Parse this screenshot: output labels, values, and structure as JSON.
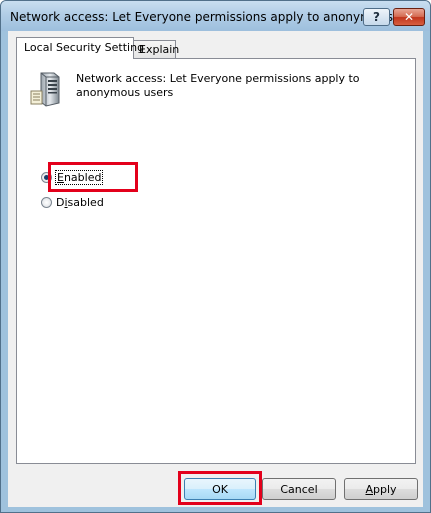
{
  "window": {
    "title": "Network access: Let Everyone permissions apply to anonymous...",
    "help_label": "?",
    "close_label": "✕"
  },
  "tabs": [
    {
      "label": "Local Security Setting",
      "active": true
    },
    {
      "label": "Explain",
      "active": false
    }
  ],
  "policy": {
    "icon": "server-icon",
    "description": "Network access: Let Everyone permissions apply to anonymous users"
  },
  "options": {
    "enabled": {
      "prefix": "",
      "mnemonic": "E",
      "rest": "nabled",
      "checked": true
    },
    "disabled": {
      "prefix": "D",
      "mnemonic": "i",
      "rest": "sabled",
      "checked": false
    }
  },
  "buttons": {
    "ok": "OK",
    "cancel": "Cancel",
    "apply_mnemonic": "A",
    "apply_rest": "pply"
  },
  "colors": {
    "highlight": "#e3001b",
    "ok_button_border": "#3c7fb1",
    "frame": "#9fc2dd"
  }
}
